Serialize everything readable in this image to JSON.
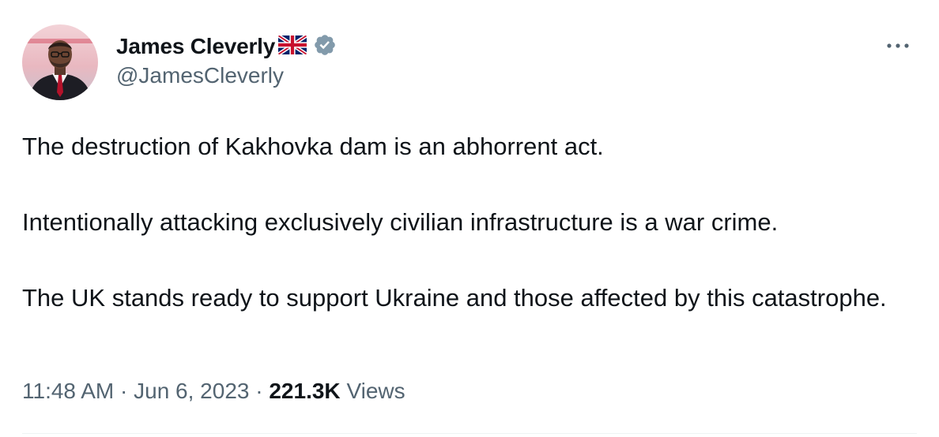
{
  "author": {
    "display_name": "James Cleverly",
    "handle": "@JamesCleverly",
    "flag_icon": "uk-flag-icon",
    "verified_icon": "verified-badge-icon",
    "verified_color": "#829aab"
  },
  "menu": {
    "more_icon": "more-options-icon",
    "more_label": "···"
  },
  "tweet": {
    "paragraphs": [
      "The destruction of Kakhovka dam is an abhorrent act.",
      "Intentionally attacking exclusively civilian infrastructure is a war crime.",
      "The UK stands ready to support Ukraine and those affected by this catastrophe."
    ]
  },
  "meta": {
    "time": "11:48 AM",
    "separator": "·",
    "date": "Jun 6, 2023",
    "views_count": "221.3K",
    "views_label": "Views"
  },
  "colors": {
    "text_primary": "#0f1419",
    "text_secondary": "#536471",
    "divider": "#eff3f4"
  }
}
